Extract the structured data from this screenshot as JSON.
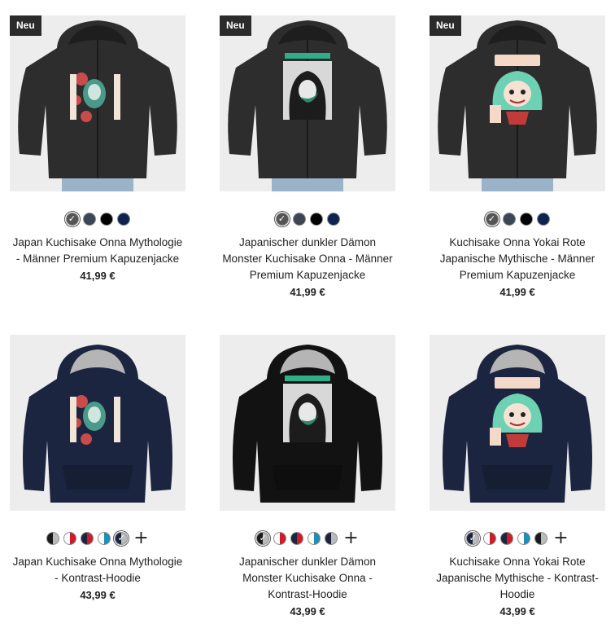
{
  "products": [
    {
      "badge": "Neu",
      "title": "Japan Kuchisake Onna Mythologie - Männer Premium Kapuzenjacke",
      "price": "41,99 €",
      "garment": "zip",
      "garment_color": "#2d2d2d",
      "hood_inner": "#2d2d2d",
      "print": "mask-green",
      "swatches": [
        {
          "colors": [
            "#555555"
          ],
          "selected": true
        },
        {
          "colors": [
            "#3b4656"
          ]
        },
        {
          "colors": [
            "#000000"
          ]
        },
        {
          "colors": [
            "#0f2350"
          ]
        }
      ],
      "more_colors": false
    },
    {
      "badge": "Neu",
      "title": "Japanischer dunkler Dämon Monster Kuchisake Onna - Männer Premium Kapuzenjacke",
      "price": "41,99 €",
      "garment": "zip",
      "garment_color": "#2d2d2d",
      "hood_inner": "#2d2d2d",
      "print": "demon-bw",
      "swatches": [
        {
          "colors": [
            "#555555"
          ],
          "selected": true
        },
        {
          "colors": [
            "#3b4656"
          ]
        },
        {
          "colors": [
            "#000000"
          ]
        },
        {
          "colors": [
            "#0f2350"
          ]
        }
      ],
      "more_colors": false
    },
    {
      "badge": "Neu",
      "title": "Kuchisake Onna Yokai Rote Japanische Mythische - Männer Premium Kapuzenjacke",
      "price": "41,99 €",
      "garment": "zip",
      "garment_color": "#2d2d2d",
      "hood_inner": "#2d2d2d",
      "print": "girl-chibi",
      "swatches": [
        {
          "colors": [
            "#555555"
          ],
          "selected": true
        },
        {
          "colors": [
            "#3b4656"
          ]
        },
        {
          "colors": [
            "#000000"
          ]
        },
        {
          "colors": [
            "#0f2350"
          ]
        }
      ],
      "more_colors": false
    },
    {
      "badge": "",
      "title": "Japan Kuchisake Onna Mythologie - Kontrast-Hoodie",
      "price": "43,99 €",
      "garment": "contrast",
      "garment_color": "#1b2540",
      "hood_inner": "#b5b5b5",
      "print": "mask-green",
      "swatches": [
        {
          "colors": [
            "#1a1a1a",
            "#bbbbbb"
          ]
        },
        {
          "colors": [
            "#ffffff",
            "#cc1c2a"
          ]
        },
        {
          "colors": [
            "#1b2540",
            "#cc1c2a"
          ]
        },
        {
          "colors": [
            "#ffffff",
            "#1f8fb5"
          ]
        },
        {
          "colors": [
            "#1b2540",
            "#bbbbbb"
          ],
          "selected": true
        }
      ],
      "more_colors": true
    },
    {
      "badge": "",
      "title": "Japanischer dunkler Dämon Monster Kuchisake Onna - Kontrast-Hoodie",
      "price": "43,99 €",
      "garment": "contrast",
      "garment_color": "#121212",
      "hood_inner": "#b5b5b5",
      "print": "demon-bw",
      "swatches": [
        {
          "colors": [
            "#1a1a1a",
            "#bbbbbb"
          ],
          "selected": true
        },
        {
          "colors": [
            "#ffffff",
            "#cc1c2a"
          ]
        },
        {
          "colors": [
            "#1b2540",
            "#cc1c2a"
          ]
        },
        {
          "colors": [
            "#ffffff",
            "#1f8fb5"
          ]
        },
        {
          "colors": [
            "#1b2540",
            "#bbbbbb"
          ]
        }
      ],
      "more_colors": true
    },
    {
      "badge": "",
      "title": "Kuchisake Onna Yokai Rote Japanische Mythische - Kontrast-Hoodie",
      "price": "43,99 €",
      "garment": "contrast",
      "garment_color": "#1b2540",
      "hood_inner": "#b5b5b5",
      "print": "girl-chibi",
      "swatches": [
        {
          "colors": [
            "#1b2540",
            "#bbbbbb"
          ],
          "selected": true
        },
        {
          "colors": [
            "#ffffff",
            "#cc1c2a"
          ]
        },
        {
          "colors": [
            "#1b2540",
            "#cc1c2a"
          ]
        },
        {
          "colors": [
            "#ffffff",
            "#1f8fb5"
          ]
        },
        {
          "colors": [
            "#1a1a1a",
            "#bbbbbb"
          ]
        }
      ],
      "more_colors": true
    }
  ],
  "icons": {
    "check": "check-icon",
    "plus": "plus-icon"
  }
}
